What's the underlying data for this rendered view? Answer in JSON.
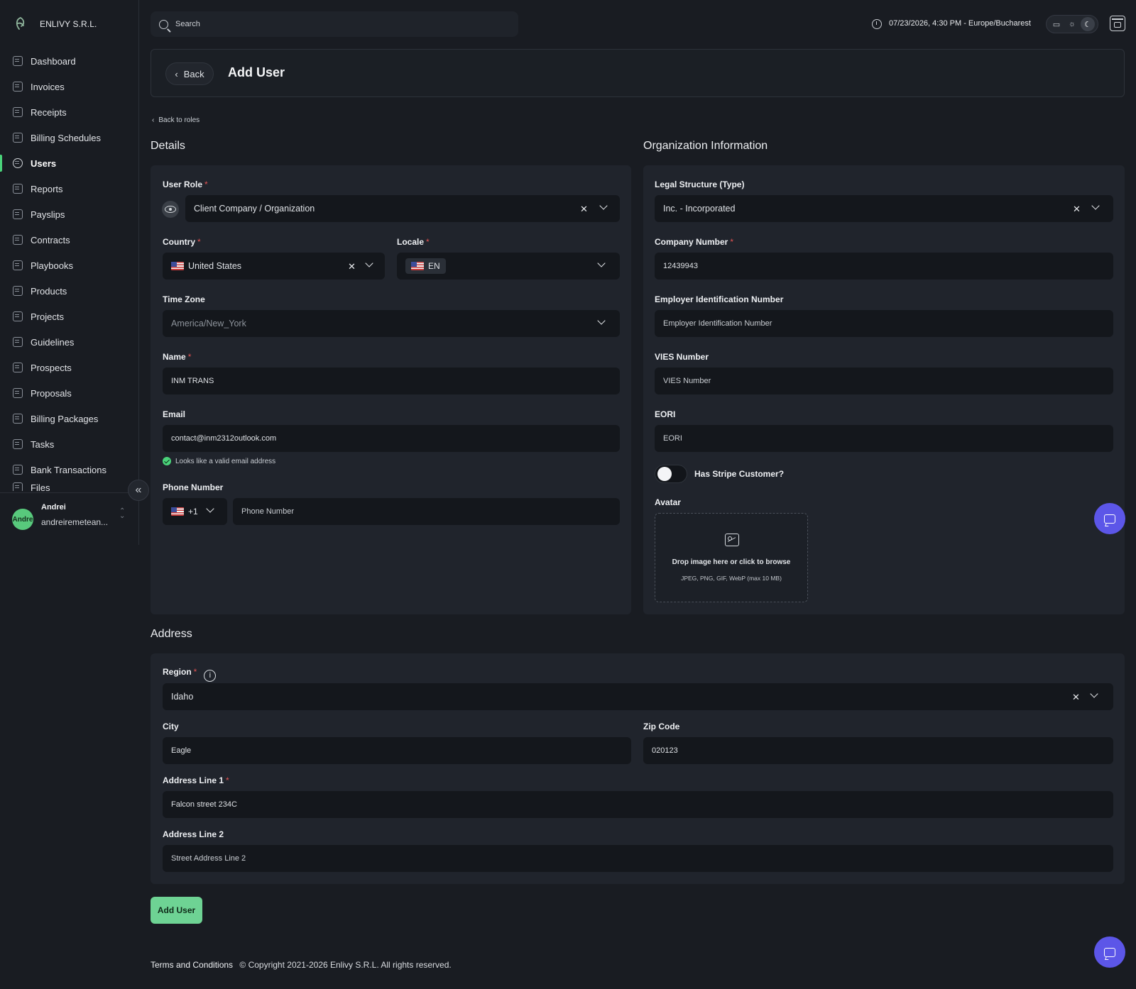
{
  "brand": {
    "name": "ENLIVY S.R.L."
  },
  "sidebar": {
    "items": [
      {
        "label": "Dashboard",
        "icon": "dashboard-icon"
      },
      {
        "label": "Invoices",
        "icon": "invoice-icon"
      },
      {
        "label": "Receipts",
        "icon": "receipt-icon"
      },
      {
        "label": "Billing Schedules",
        "icon": "calendar-icon"
      },
      {
        "label": "Users",
        "icon": "users-icon",
        "active": true
      },
      {
        "label": "Reports",
        "icon": "report-icon"
      },
      {
        "label": "Payslips",
        "icon": "payslip-icon"
      },
      {
        "label": "Contracts",
        "icon": "contract-icon"
      },
      {
        "label": "Playbooks",
        "icon": "book-icon"
      },
      {
        "label": "Products",
        "icon": "box-icon"
      },
      {
        "label": "Projects",
        "icon": "project-icon"
      },
      {
        "label": "Guidelines",
        "icon": "guideline-icon"
      },
      {
        "label": "Prospects",
        "icon": "prospect-icon"
      },
      {
        "label": "Proposals",
        "icon": "proposal-icon"
      },
      {
        "label": "Billing Packages",
        "icon": "package-icon"
      },
      {
        "label": "Tasks",
        "icon": "task-icon"
      },
      {
        "label": "Bank Transactions",
        "icon": "bank-icon"
      },
      {
        "label": "Files",
        "icon": "file-icon"
      }
    ],
    "user": {
      "name": "Andrei",
      "email": "andreiremetean...",
      "avatar_text": "Andre"
    }
  },
  "topbar": {
    "search_placeholder": "Search",
    "datetime": "07/23/2026, 4:30 PM  -  Europe/Bucharest"
  },
  "header": {
    "back_label": "Back",
    "title": "Add User"
  },
  "back_to_roles": "Back to roles",
  "details": {
    "title": "Details",
    "user_role": {
      "label": "User Role",
      "value": "Client Company / Organization"
    },
    "country": {
      "label": "Country",
      "value": "United States"
    },
    "locale": {
      "label": "Locale",
      "value": "EN"
    },
    "timezone": {
      "label": "Time Zone",
      "value": "America/New_York"
    },
    "name": {
      "label": "Name",
      "value": "INM TRANS"
    },
    "email": {
      "label": "Email",
      "value": "contact@inm2312outlook.com",
      "hint": "Looks like a valid email address"
    },
    "phone": {
      "label": "Phone Number",
      "code": "+1",
      "placeholder": "Phone Number"
    }
  },
  "organization": {
    "title": "Organization Information",
    "legal_structure": {
      "label": "Legal Structure (Type)",
      "value": "Inc. - Incorporated"
    },
    "company_number": {
      "label": "Company Number",
      "value": "12439943"
    },
    "ein": {
      "label": "Employer Identification Number",
      "placeholder": "Employer Identification Number"
    },
    "vies": {
      "label": "VIES Number",
      "placeholder": "VIES Number"
    },
    "eori": {
      "label": "EORI",
      "placeholder": "EORI"
    },
    "stripe": {
      "label": "Has Stripe Customer?",
      "on": false
    },
    "avatar": {
      "label": "Avatar",
      "drop_text": "Drop image here or click to browse",
      "formats": "JPEG, PNG, GIF, WebP (max 10 MB)"
    }
  },
  "address": {
    "title": "Address",
    "region": {
      "label": "Region",
      "value": "Idaho"
    },
    "city": {
      "label": "City",
      "value": "Eagle"
    },
    "zip": {
      "label": "Zip Code",
      "value": "020123"
    },
    "line1": {
      "label": "Address Line 1",
      "value": "Falcon street 234C"
    },
    "line2": {
      "label": "Address Line 2",
      "placeholder": "Street Address Line 2"
    }
  },
  "submit_label": "Add User",
  "footer": {
    "terms": "Terms and Conditions",
    "copyright": "© Copyright 2021-2026 Enlivy S.R.L. All rights reserved."
  },
  "colors": {
    "accent": "#4ad27a",
    "submit": "#6ed394",
    "chat": "#5c56e8",
    "background": "#191c22",
    "card": "#20242c",
    "input": "#14171c"
  }
}
